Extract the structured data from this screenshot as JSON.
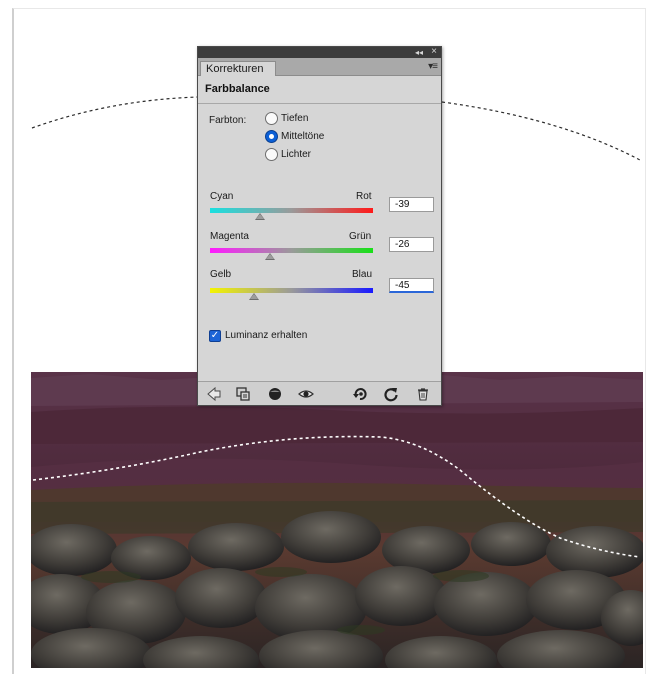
{
  "panel": {
    "tab_label": "Korrekturen",
    "heading": "Farbbalance",
    "collapse_glyph": "◂◂",
    "close_glyph": "×",
    "menu_glyph": "▾≡"
  },
  "tone": {
    "label": "Farbton:",
    "options": [
      {
        "label": "Tiefen",
        "selected": false
      },
      {
        "label": "Mitteltöne",
        "selected": true
      },
      {
        "label": "Lichter",
        "selected": false
      }
    ]
  },
  "sliders": [
    {
      "left_label": "Cyan",
      "right_label": "Rot",
      "value": "-39",
      "left_color": "#19e0e0",
      "right_color": "#ff1a1a"
    },
    {
      "left_label": "Magenta",
      "right_label": "Grün",
      "value": "-26",
      "left_color": "#ff1aff",
      "right_color": "#19e019"
    },
    {
      "left_label": "Gelb",
      "right_label": "Blau",
      "value": "-45",
      "left_color": "#f4f400",
      "right_color": "#1a1aff"
    }
  ],
  "luminance": {
    "label": "Luminanz erhalten",
    "checked": true
  },
  "toolbar_icons": [
    "back-arrow-icon",
    "clip-to-layer-icon",
    "visibility-toggle-icon",
    "eye-icon",
    "previous-state-icon",
    "reset-icon",
    "trash-icon"
  ]
}
